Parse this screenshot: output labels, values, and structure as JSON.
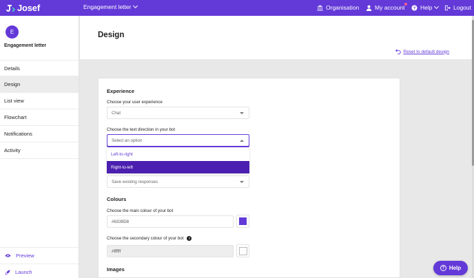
{
  "topbar": {
    "logo": "Josef",
    "bot_selector": "Engagement letter",
    "organisation": "Organisation",
    "my_account": "My account",
    "help": "Help",
    "logout": "Logout"
  },
  "sidebar": {
    "avatar_letter": "E",
    "bot_name": "Engagement letter",
    "items": [
      {
        "label": "Details"
      },
      {
        "label": "Design"
      },
      {
        "label": "List view"
      },
      {
        "label": "Flowchart"
      },
      {
        "label": "Notifications"
      },
      {
        "label": "Activity"
      }
    ],
    "active_item": "Design",
    "preview": "Preview",
    "launch": "Launch"
  },
  "header": {
    "title": "Design",
    "reset_link": "Reset to default design"
  },
  "experience": {
    "title": "Experience",
    "ux_label": "Choose your user experience",
    "ux_value": "Chat",
    "direction_label": "Choose the text direction in your bot",
    "direction_placeholder": "Select an option",
    "direction_options": [
      "Left-to-right",
      "Right-to-left"
    ],
    "responses_value": "Save existing responses"
  },
  "colours": {
    "title": "Colours",
    "main_label": "Choose the main colour of your bot",
    "main_value": "#6339D8",
    "secondary_label": "Choose the secondary colour of your bot",
    "secondary_value": "#ffffff",
    "main_swatch": "#6339d8",
    "secondary_swatch": "#ffffff",
    "info_icon": "i"
  },
  "images": {
    "title": "Images"
  },
  "help_button": "Help",
  "help_icon": "?",
  "accent_color": "#6339d8"
}
